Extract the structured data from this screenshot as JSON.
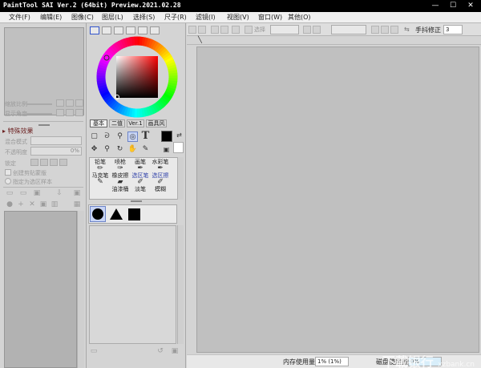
{
  "window": {
    "title": "PaintTool SAI Ver.2 (64bit) Preview.2021.02.28",
    "minimize_glyph": "—",
    "maximize_glyph": "☐",
    "close_glyph": "✕"
  },
  "menu": {
    "items": [
      "文件(F)",
      "编辑(E)",
      "图像(C)",
      "图层(L)",
      "选择(S)",
      "尺子(R)",
      "滤镜(I)",
      "视图(V)",
      "窗口(W)",
      "其他(O)"
    ]
  },
  "left_panel": {
    "zoom_label": "缩放比例",
    "rotate_label": "显示角度",
    "section_title": "特殊效果",
    "blend_mode_label": "混合模式",
    "opacity_label": "不透明度",
    "opacity_value": "0%",
    "lock_label": "锁定",
    "clipping_label": "创建剪贴蒙版",
    "selection_source_label": "指定为选区样本"
  },
  "tools": {
    "tabs": [
      "基本",
      "二值",
      "Ver.1",
      "画具风"
    ],
    "text_tool_glyph": "T",
    "brushes": [
      {
        "name": "铅笔"
      },
      {
        "name": "喷枪"
      },
      {
        "name": "画笔"
      },
      {
        "name": "水彩笔"
      },
      {
        "name": "马克笔"
      },
      {
        "name": "橡皮擦"
      },
      {
        "name": "选区笔"
      },
      {
        "name": "选区擦"
      },
      {
        "name": "油漆桶"
      },
      {
        "name": "淡笔"
      },
      {
        "name": "模糊"
      }
    ]
  },
  "toolbar": {
    "select_label": "选择",
    "stabilizer_label": "手抖修正",
    "stabilizer_value": "3"
  },
  "status": {
    "memory_label": "内存使用量",
    "memory_value": "1% (1%)",
    "disk_label": "磁盘使用量",
    "disk_value": "0%"
  },
  "watermark": {
    "text": "下载银行",
    "domain": "xzbank.cn"
  },
  "colors": {
    "hue_wheel_selected": "#ff0000",
    "foreground": "#000000",
    "background": "#ffffff",
    "canvas": "#c0c0c0",
    "disk_bar": "#78c8f0"
  }
}
